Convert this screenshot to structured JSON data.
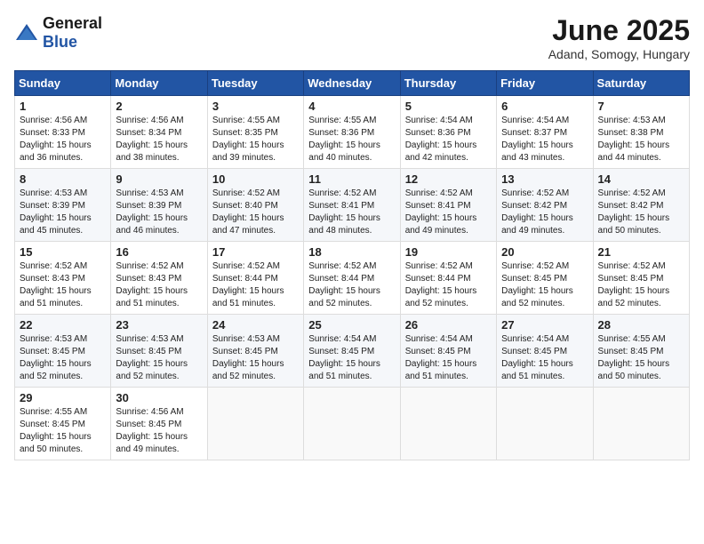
{
  "logo": {
    "general": "General",
    "blue": "Blue"
  },
  "title": "June 2025",
  "location": "Adand, Somogy, Hungary",
  "weekdays": [
    "Sunday",
    "Monday",
    "Tuesday",
    "Wednesday",
    "Thursday",
    "Friday",
    "Saturday"
  ],
  "weeks": [
    [
      {
        "day": "1",
        "sunrise": "4:56 AM",
        "sunset": "8:33 PM",
        "daylight": "15 hours and 36 minutes."
      },
      {
        "day": "2",
        "sunrise": "4:56 AM",
        "sunset": "8:34 PM",
        "daylight": "15 hours and 38 minutes."
      },
      {
        "day": "3",
        "sunrise": "4:55 AM",
        "sunset": "8:35 PM",
        "daylight": "15 hours and 39 minutes."
      },
      {
        "day": "4",
        "sunrise": "4:55 AM",
        "sunset": "8:36 PM",
        "daylight": "15 hours and 40 minutes."
      },
      {
        "day": "5",
        "sunrise": "4:54 AM",
        "sunset": "8:36 PM",
        "daylight": "15 hours and 42 minutes."
      },
      {
        "day": "6",
        "sunrise": "4:54 AM",
        "sunset": "8:37 PM",
        "daylight": "15 hours and 43 minutes."
      },
      {
        "day": "7",
        "sunrise": "4:53 AM",
        "sunset": "8:38 PM",
        "daylight": "15 hours and 44 minutes."
      }
    ],
    [
      {
        "day": "8",
        "sunrise": "4:53 AM",
        "sunset": "8:39 PM",
        "daylight": "15 hours and 45 minutes."
      },
      {
        "day": "9",
        "sunrise": "4:53 AM",
        "sunset": "8:39 PM",
        "daylight": "15 hours and 46 minutes."
      },
      {
        "day": "10",
        "sunrise": "4:52 AM",
        "sunset": "8:40 PM",
        "daylight": "15 hours and 47 minutes."
      },
      {
        "day": "11",
        "sunrise": "4:52 AM",
        "sunset": "8:41 PM",
        "daylight": "15 hours and 48 minutes."
      },
      {
        "day": "12",
        "sunrise": "4:52 AM",
        "sunset": "8:41 PM",
        "daylight": "15 hours and 49 minutes."
      },
      {
        "day": "13",
        "sunrise": "4:52 AM",
        "sunset": "8:42 PM",
        "daylight": "15 hours and 49 minutes."
      },
      {
        "day": "14",
        "sunrise": "4:52 AM",
        "sunset": "8:42 PM",
        "daylight": "15 hours and 50 minutes."
      }
    ],
    [
      {
        "day": "15",
        "sunrise": "4:52 AM",
        "sunset": "8:43 PM",
        "daylight": "15 hours and 51 minutes."
      },
      {
        "day": "16",
        "sunrise": "4:52 AM",
        "sunset": "8:43 PM",
        "daylight": "15 hours and 51 minutes."
      },
      {
        "day": "17",
        "sunrise": "4:52 AM",
        "sunset": "8:44 PM",
        "daylight": "15 hours and 51 minutes."
      },
      {
        "day": "18",
        "sunrise": "4:52 AM",
        "sunset": "8:44 PM",
        "daylight": "15 hours and 52 minutes."
      },
      {
        "day": "19",
        "sunrise": "4:52 AM",
        "sunset": "8:44 PM",
        "daylight": "15 hours and 52 minutes."
      },
      {
        "day": "20",
        "sunrise": "4:52 AM",
        "sunset": "8:45 PM",
        "daylight": "15 hours and 52 minutes."
      },
      {
        "day": "21",
        "sunrise": "4:52 AM",
        "sunset": "8:45 PM",
        "daylight": "15 hours and 52 minutes."
      }
    ],
    [
      {
        "day": "22",
        "sunrise": "4:53 AM",
        "sunset": "8:45 PM",
        "daylight": "15 hours and 52 minutes."
      },
      {
        "day": "23",
        "sunrise": "4:53 AM",
        "sunset": "8:45 PM",
        "daylight": "15 hours and 52 minutes."
      },
      {
        "day": "24",
        "sunrise": "4:53 AM",
        "sunset": "8:45 PM",
        "daylight": "15 hours and 52 minutes."
      },
      {
        "day": "25",
        "sunrise": "4:54 AM",
        "sunset": "8:45 PM",
        "daylight": "15 hours and 51 minutes."
      },
      {
        "day": "26",
        "sunrise": "4:54 AM",
        "sunset": "8:45 PM",
        "daylight": "15 hours and 51 minutes."
      },
      {
        "day": "27",
        "sunrise": "4:54 AM",
        "sunset": "8:45 PM",
        "daylight": "15 hours and 51 minutes."
      },
      {
        "day": "28",
        "sunrise": "4:55 AM",
        "sunset": "8:45 PM",
        "daylight": "15 hours and 50 minutes."
      }
    ],
    [
      {
        "day": "29",
        "sunrise": "4:55 AM",
        "sunset": "8:45 PM",
        "daylight": "15 hours and 50 minutes."
      },
      {
        "day": "30",
        "sunrise": "4:56 AM",
        "sunset": "8:45 PM",
        "daylight": "15 hours and 49 minutes."
      },
      null,
      null,
      null,
      null,
      null
    ]
  ],
  "labels": {
    "sunrise": "Sunrise:",
    "sunset": "Sunset:",
    "daylight": "Daylight:"
  }
}
